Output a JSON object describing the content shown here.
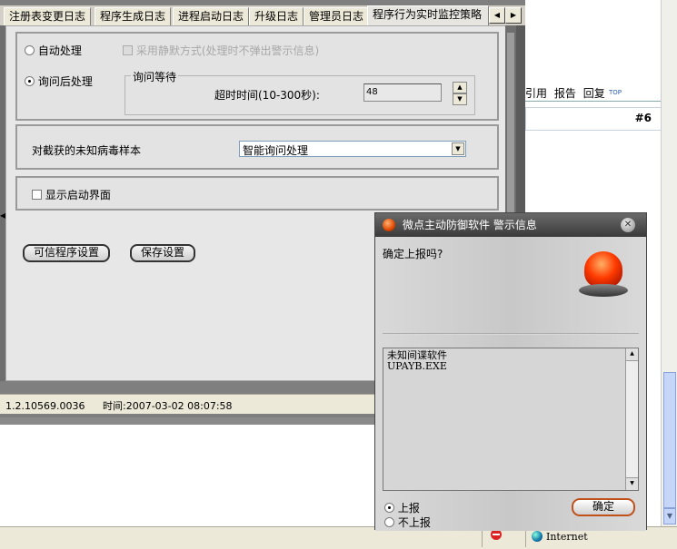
{
  "background": {
    "links": [
      "引用",
      "报告",
      "回复"
    ],
    "top_badge": "TOP",
    "post_number": "#6",
    "statusbar_zone": "Internet"
  },
  "app": {
    "tabs": [
      {
        "label": "注册表变更日志"
      },
      {
        "label": "程序生成日志"
      },
      {
        "label": "进程启动日志"
      },
      {
        "label": "升级日志"
      },
      {
        "label": "管理员日志"
      },
      {
        "label": "程序行为实时监控策略",
        "active": true
      }
    ],
    "group1": {
      "auto_label": "自动处理",
      "silent_label": "采用静默方式(处理时不弹出警示信息)",
      "ask_label": "询问后处理",
      "wait_legend": "询问等待",
      "timeout_label": "超时时间(10-300秒):",
      "timeout_value": "48"
    },
    "group2": {
      "label": "对截获的未知病毒样本",
      "select_value": "智能询问处理"
    },
    "group3": {
      "label": "显示启动界面"
    },
    "buttons": {
      "trusted": "可信程序设置",
      "save": "保存设置"
    },
    "status": {
      "version": "1.2.10569.0036",
      "time_label": "时间:",
      "time_value": "2007-03-02 08:07:58"
    }
  },
  "alert": {
    "title": "微点主动防御软件  警示信息",
    "question": "确定上报吗?",
    "message_line1": "未知间谍软件",
    "message_line2": "UPAYB.EXE",
    "option_report": "上报",
    "option_noreport": "不上报",
    "ok": "确定"
  }
}
